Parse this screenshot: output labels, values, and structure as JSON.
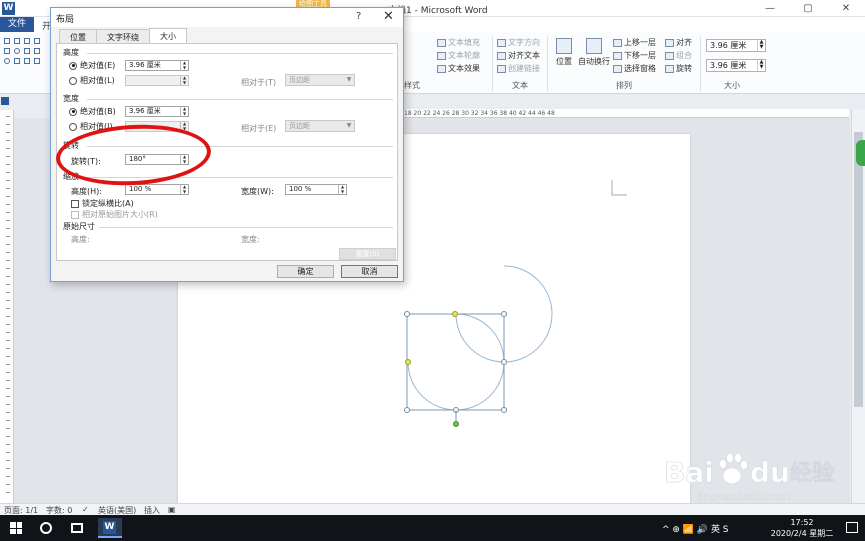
{
  "window": {
    "title": "文档1 - Microsoft Word",
    "app_icon": "W",
    "context_tab": "绘图工具",
    "controls": [
      "—",
      "▢",
      "✕"
    ]
  },
  "ribbon": {
    "file_tab": "文件",
    "tab_stub": "开",
    "items": {
      "text_fill": "文本填充",
      "text_outline": "文本轮廓",
      "text_effect": "文本效果",
      "text_direction": "文字方向",
      "align_text": "对齐文本",
      "create_link": "创建链接",
      "position": "位置",
      "wrap_text": "自动换行",
      "bring_forward": "上移一层",
      "send_backward": "下移一层",
      "selection_pane": "选择窗格",
      "align": "对齐",
      "group": "组合",
      "rotate": "旋转"
    },
    "groups": {
      "wordart": "样式",
      "text": "文本",
      "arrange": "排列",
      "size": "大小"
    },
    "size": {
      "height": "3.96 厘米",
      "width": "3.96 厘米"
    }
  },
  "ruler_text": "18  20  22  24  26  28  30  32  34  36  38  40  42  44  46  48",
  "dialog": {
    "title": "布局",
    "help": "?",
    "close": "✕",
    "tabs": [
      "位置",
      "文字环绕",
      "大小"
    ],
    "height_section": "高度",
    "absolute_label": "绝对值(E)",
    "relative_label": "相对值(L)",
    "height_abs_value": "3.96 厘米",
    "relative_to_label": "相对于(T)",
    "relative_to_value": "页边距",
    "width_section": "宽度",
    "width_abs_label": "绝对值(B)",
    "width_rel_label": "相对值(I)",
    "width_abs_value": "3.96 厘米",
    "width_relative_to_label": "相对于(E)",
    "width_relative_to_value": "页边距",
    "rotate_section": "旋转",
    "rotate_label": "旋转(T):",
    "rotate_value": "180°",
    "scale_section": "缩放",
    "scale_height_label": "高度(H):",
    "scale_height_value": "100 %",
    "scale_width_label": "宽度(W):",
    "scale_width_value": "100 %",
    "lock_aspect_label": "锁定纵横比(A)",
    "relative_original_label": "相对原始图片大小(R)",
    "original_size_section": "原始尺寸",
    "orig_height_label": "高度:",
    "orig_width_label": "宽度:",
    "reset_button": "重置(S)",
    "ok_button": "确定",
    "cancel_button": "取消"
  },
  "statusbar": {
    "page": "页面: 1/1",
    "words": "字数: 0",
    "language": "英语(美国)",
    "mode": "插入"
  },
  "taskbar": {
    "tray": "^  ⊕  📶  🔊  英  S",
    "ime": "英",
    "time": "17:52",
    "date": "2020/2/4 星期二"
  },
  "watermark": {
    "brand": "Bai",
    "brand2": "du",
    "brand_cn": "经验",
    "url": "jingyan.baidu.com"
  }
}
